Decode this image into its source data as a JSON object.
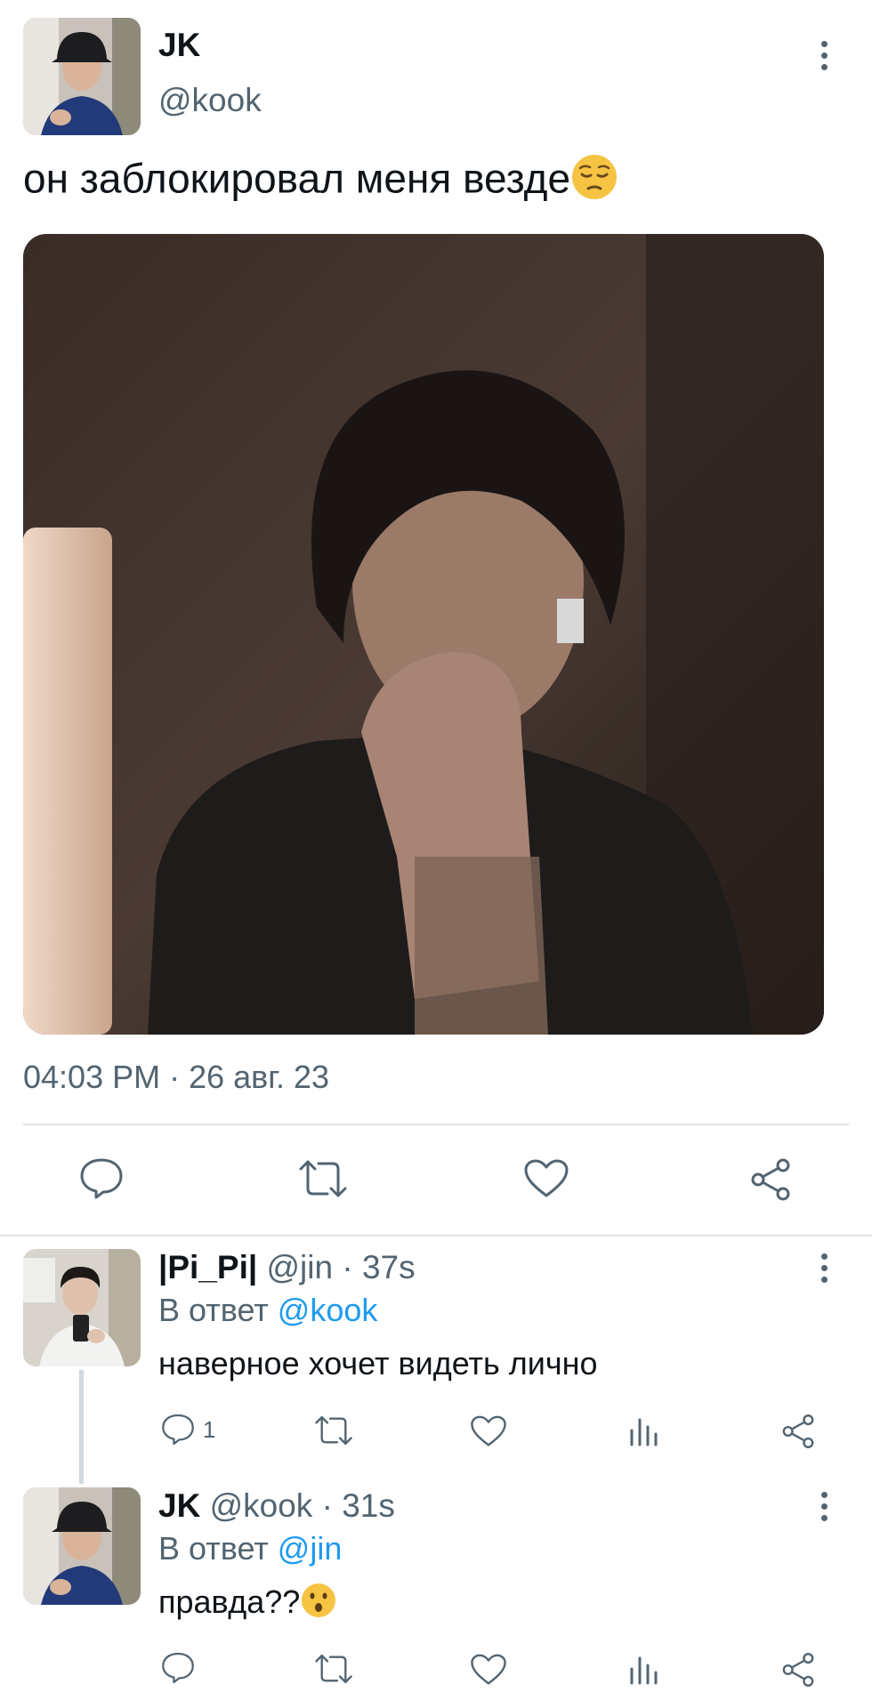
{
  "tweet": {
    "author_name": "JK",
    "author_handle": "@kook",
    "text": "он заблокировал меня везде",
    "text_emoji": "pensive-face-emoji",
    "timestamp": "04:03 PM · 26 авг. 23",
    "actions": [
      "reply",
      "retweet",
      "like",
      "share"
    ]
  },
  "replies": [
    {
      "name": "|Pi_Pi|",
      "handle": "@jin",
      "time": "· 37s",
      "reply_prefix": "В ответ",
      "reply_to": "@kook",
      "text": "наверное хочет видеть лично",
      "reply_count": "1"
    },
    {
      "name": "JK",
      "handle": "@kook",
      "time": "· 31s",
      "reply_prefix": "В ответ",
      "reply_to": "@jin",
      "text": "правда??",
      "text_emoji": "hushed-face-emoji",
      "reply_count": ""
    }
  ],
  "colors": {
    "text": "#0f1419",
    "secondary": "#536471",
    "link": "#1d9bf0",
    "divider": "#e1e5e8"
  }
}
